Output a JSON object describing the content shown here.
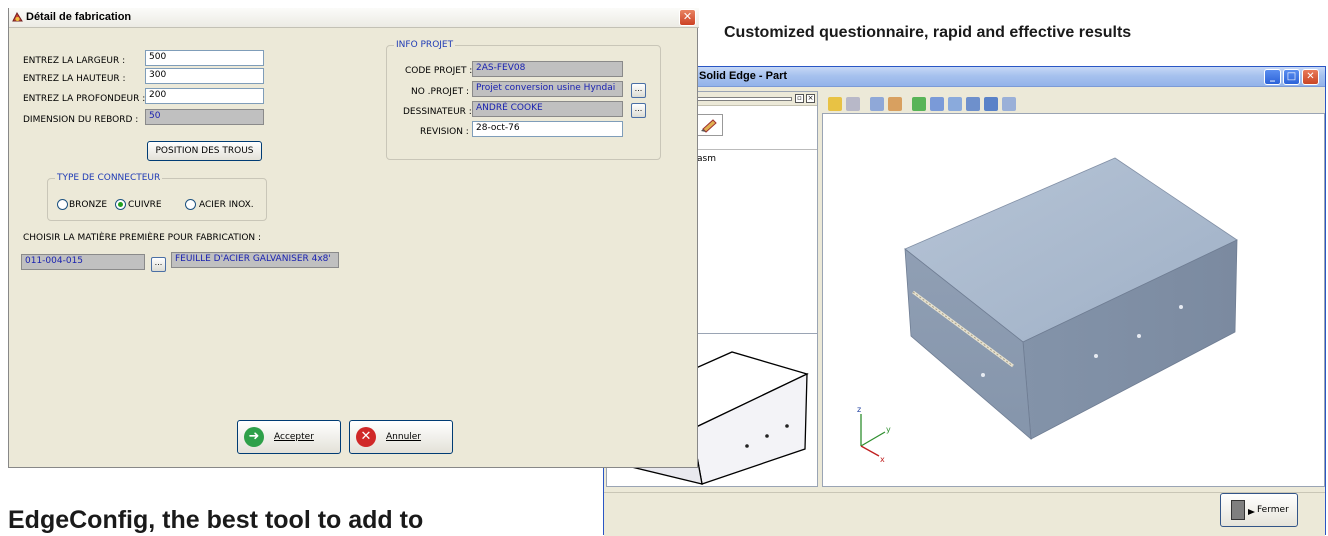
{
  "captions": {
    "top_right": "Customized questionnaire, rapid and effective results",
    "bottom_left": "EdgeConfig, the best tool to add to"
  },
  "solid_edge": {
    "title": "Solid Edge - Part",
    "tree_item": "asm",
    "close_button": "Fermer",
    "window_controls": [
      "_",
      "□",
      "✕"
    ]
  },
  "dialog": {
    "title": "Détail de fabrication",
    "close_glyph": "✕",
    "fields": {
      "largeur_label": "ENTREZ LA LARGEUR :",
      "largeur_value": "500",
      "hauteur_label": "ENTREZ LA HAUTEUR :",
      "hauteur_value": "300",
      "profondeur_label": "ENTREZ LA PROFONDEUR :",
      "profondeur_value": "200",
      "rebord_label": "DIMENSION DU REBORD :",
      "rebord_value": "50"
    },
    "position_button": "POSITION DES TROUS",
    "connector_group": {
      "legend": "TYPE DE CONNECTEUR",
      "options": [
        "BRONZE",
        "CUIVRE",
        "ACIER INOX."
      ],
      "selected": "CUIVRE"
    },
    "material": {
      "label": "CHOISIR LA MATIÈRE PREMIÈRE POUR FABRICATION :",
      "code": "011-004-015",
      "description": "FEUILLE D'ACIER GALVANISER 4x8'"
    },
    "project": {
      "legend": "INFO PROJET",
      "code_label": "CODE PROJET :",
      "code_value": "2AS-FEV08",
      "no_label": "NO .PROJET :",
      "no_value": "Projet conversion usine Hyndai",
      "designer_label": "DESSINATEUR :",
      "designer_value": "ANDRÉ COOKE",
      "revision_label": "REVISION :",
      "revision_value": "28-oct-76"
    },
    "ellipsis": "...",
    "accept_button": "Accepter",
    "cancel_button": "Annuler"
  }
}
